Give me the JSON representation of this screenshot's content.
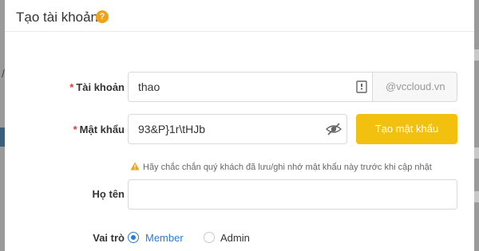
{
  "modal": {
    "title": "Tạo tài khoản",
    "help_icon": "question-circle-icon"
  },
  "form": {
    "username": {
      "label": "Tài khoản",
      "required": true,
      "value": "thao",
      "suffix": "@vccloud.vn",
      "icon": "contact-card-icon"
    },
    "password": {
      "label": "Mật khẩu",
      "required": true,
      "value": "93&P}1r\\tHJb",
      "icon": "hide-password-icon",
      "generate_label": "Tạo mật khẩu"
    },
    "warning": {
      "icon": "warning-triangle-icon",
      "text": "Hãy chắc chắn quý khách đã lưu/ghi nhớ mật khẩu này trước khi cập nhật"
    },
    "fullname": {
      "label": "Họ tên",
      "value": ""
    },
    "role": {
      "label": "Vai trò",
      "options": [
        "Member",
        "Admin"
      ],
      "selected": "Member"
    }
  },
  "colors": {
    "accent_yellow": "#f2c10f",
    "radio_blue": "#2b7bd6",
    "required_red": "#e33333",
    "warning_orange": "#f0a318"
  }
}
